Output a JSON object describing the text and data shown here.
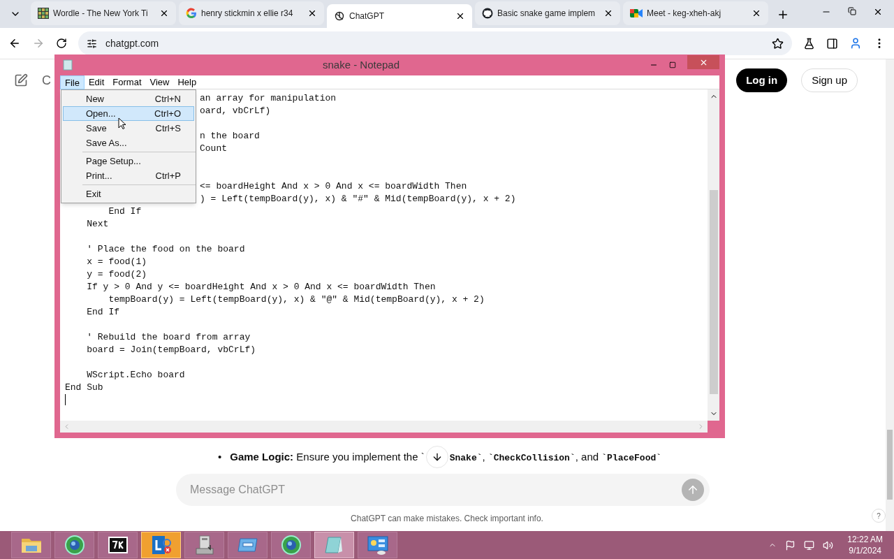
{
  "browser": {
    "tabs": [
      {
        "title": "Wordle - The New York Ti",
        "selected": false
      },
      {
        "title": "henry stickmin x ellie r34",
        "selected": false
      },
      {
        "title": "ChatGPT",
        "selected": true
      },
      {
        "title": "Basic snake game implem",
        "selected": false
      },
      {
        "title": "Meet - keg-xheh-akj",
        "selected": false
      }
    ],
    "address": "chatgpt.com"
  },
  "page": {
    "title_fragment": "C",
    "login": "Log in",
    "signup": "Sign up",
    "bullet": {
      "marker": "•",
      "before": [
        {
          "kind": "bold",
          "text": "Game Logic:"
        },
        {
          "kind": "text",
          "text": " Ensure you implement the `"
        }
      ],
      "after": [
        {
          "kind": "code",
          "text": "Snake`"
        },
        {
          "kind": "text",
          "text": ", "
        },
        {
          "kind": "code",
          "text": "`CheckCollision`"
        },
        {
          "kind": "text",
          "text": ", and "
        },
        {
          "kind": "code",
          "text": "`PlaceFood`"
        }
      ]
    },
    "message_placeholder": "Message ChatGPT",
    "disclaimer": "ChatGPT can make mistakes. Check important info.",
    "help": "?"
  },
  "notepad": {
    "title": "snake - Notepad",
    "menu": [
      {
        "label": "File",
        "open": true
      },
      {
        "label": "Edit",
        "open": false
      },
      {
        "label": "Format",
        "open": false
      },
      {
        "label": "View",
        "open": false
      },
      {
        "label": "Help",
        "open": false
      }
    ],
    "file_menu": [
      {
        "label": "New",
        "shortcut": "Ctrl+N",
        "selected": false,
        "separator_before": false
      },
      {
        "label": "Open...",
        "shortcut": "Ctrl+O",
        "selected": true,
        "separator_before": false
      },
      {
        "label": "Save",
        "shortcut": "Ctrl+S",
        "selected": false,
        "separator_before": false
      },
      {
        "label": "Save As...",
        "selected": false,
        "separator_before": false
      },
      {
        "label": "Page Setup...",
        "selected": false,
        "separator_before": true
      },
      {
        "label": "Print...",
        "shortcut": "Ctrl+P",
        "selected": false,
        "separator_before": false
      },
      {
        "label": "Exit",
        "selected": false,
        "separator_before": true
      }
    ],
    "lines": [
      {
        "kind": "clipped",
        "text": "an array for manipulation"
      },
      {
        "kind": "clipped",
        "text": "oard, vbCrLf)"
      },
      {
        "kind": "blank"
      },
      {
        "kind": "clipped",
        "text": "n the board"
      },
      {
        "kind": "clipped",
        "text": "Count"
      },
      {
        "kind": "blank"
      },
      {
        "kind": "blank"
      },
      {
        "kind": "clipped",
        "text": "<= boardHeight And x > 0 And x <= boardWidth Then"
      },
      {
        "kind": "clipped",
        "text": ") = Left(tempBoard(y), x) & \"#\" & Mid(tempBoard(y), x + 2)"
      },
      {
        "kind": "code",
        "text": "        End If"
      },
      {
        "kind": "code",
        "text": "    Next"
      },
      {
        "kind": "blank"
      },
      {
        "kind": "code",
        "text": "    ' Place the food on the board"
      },
      {
        "kind": "code",
        "text": "    x = food(1)"
      },
      {
        "kind": "code",
        "text": "    y = food(2)"
      },
      {
        "kind": "code",
        "text": "    If y > 0 And y <= boardHeight And x > 0 And x <= boardWidth Then"
      },
      {
        "kind": "code",
        "text": "        tempBoard(y) = Left(tempBoard(y), x) & \"@\" & Mid(tempBoard(y), x + 2)"
      },
      {
        "kind": "code",
        "text": "    End If"
      },
      {
        "kind": "blank"
      },
      {
        "kind": "code",
        "text": "    ' Rebuild the board from array"
      },
      {
        "kind": "code",
        "text": "    board = Join(tempBoard, vbCrLf)"
      },
      {
        "kind": "blank"
      },
      {
        "kind": "code",
        "text": "    WScript.Echo board"
      },
      {
        "kind": "code",
        "text": "End Sub"
      }
    ]
  },
  "taskbar": {
    "apps": [
      {
        "kind": "folder",
        "active": false
      },
      {
        "kind": "browser",
        "active": false
      },
      {
        "kind": "archiver",
        "active": false
      },
      {
        "kind": "lync",
        "active": true
      },
      {
        "kind": "installer",
        "active": false
      },
      {
        "kind": "window",
        "active": false
      },
      {
        "kind": "browser",
        "active": false
      },
      {
        "kind": "notepad",
        "active": true
      },
      {
        "kind": "control",
        "active": false
      }
    ],
    "time": "12:22 AM",
    "date": "9/1/2024"
  }
}
